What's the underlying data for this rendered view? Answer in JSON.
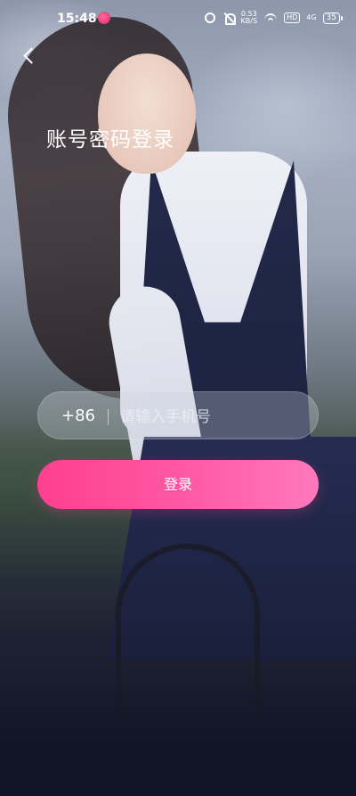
{
  "status_bar": {
    "time": "15:48",
    "speed_value": "0.53",
    "speed_unit": "KB/S",
    "signal": "4G",
    "hd": "HD",
    "battery": "35"
  },
  "header": {
    "title": "账号密码登录"
  },
  "phone_field": {
    "country_code": "+86",
    "placeholder": "请输入手机号",
    "value": ""
  },
  "login_button": {
    "label": "登录"
  },
  "colors": {
    "button_gradient_start": "#ff3f8f",
    "button_gradient_end": "#ff79bd"
  }
}
